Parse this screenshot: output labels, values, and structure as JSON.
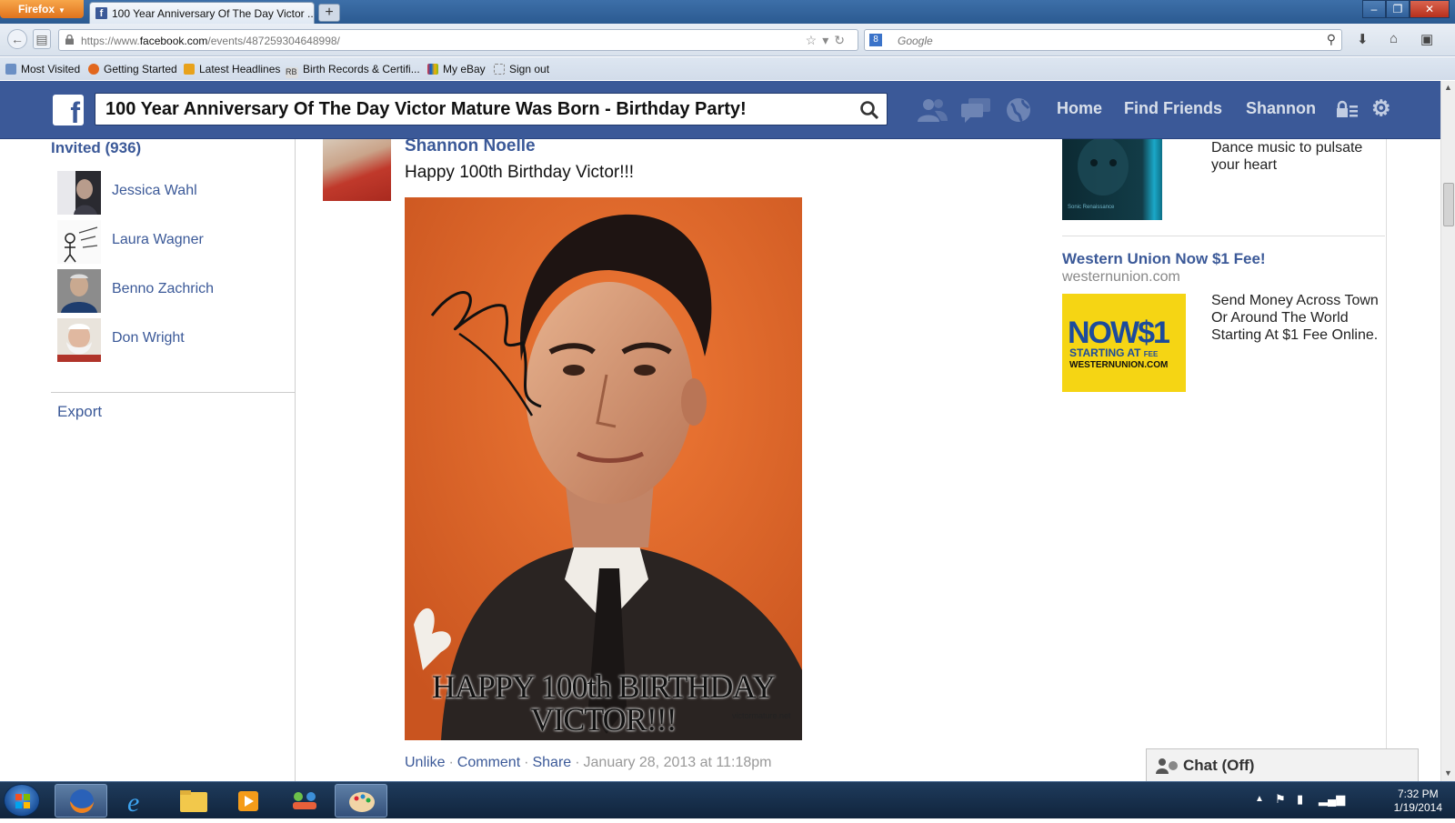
{
  "browser": {
    "app_button": "Firefox",
    "tab_title": "100 Year Anniversary Of The Day Victor ...",
    "new_tab": "+",
    "url_prefix": "https://www.",
    "url_domain": "facebook.com",
    "url_path": "/events/487259304648998/",
    "search_placeholder": "Google",
    "bookmarks": [
      "Most Visited",
      "Getting Started",
      "Latest Headlines",
      "Birth Records & Certifi...",
      "My eBay",
      "Sign out"
    ]
  },
  "facebook": {
    "search_value": "100 Year Anniversary Of The Day Victor Mature Was Born - Birthday Party!",
    "nav_links": [
      "Home",
      "Find Friends",
      "Shannon"
    ],
    "brand_color": "#3b5998"
  },
  "left": {
    "invited_title": "Invited (936)",
    "friends": [
      "Jessica Wahl",
      "Laura Wagner",
      "Benno Zachrich",
      "Don Wright"
    ],
    "export": "Export"
  },
  "post": {
    "author": "Shannon Noelle",
    "text": "Happy 100th Birthday Victor!!!",
    "photo_caption_line1": "HAPPY 100th BIRTHDAY",
    "photo_caption_line2": "VICTOR!!!",
    "photo_credit": "victormature.net",
    "actions": [
      "Unlike",
      "Comment",
      "Share"
    ],
    "timestamp": "January 28, 2013 at 11:18pm"
  },
  "ads": {
    "ad1_text": "Dance music to pulsate your heart",
    "ad1_image_caption": "Sonic Renaissance",
    "ad2_title": "Western Union Now $1 Fee!",
    "ad2_domain": "westernunion.com",
    "ad2_img_line1": "NOW$1",
    "ad2_img_line2": "STARTING AT",
    "ad2_img_line2_small": "FEE",
    "ad2_img_line3": "WESTERNUNION.COM",
    "ad2_text": "Send Money Across Town Or Around The World Starting At $1 Fee Online."
  },
  "chat": {
    "label": "Chat (Off)"
  },
  "taskbar": {
    "time": "7:32 PM",
    "date": "1/19/2014"
  }
}
